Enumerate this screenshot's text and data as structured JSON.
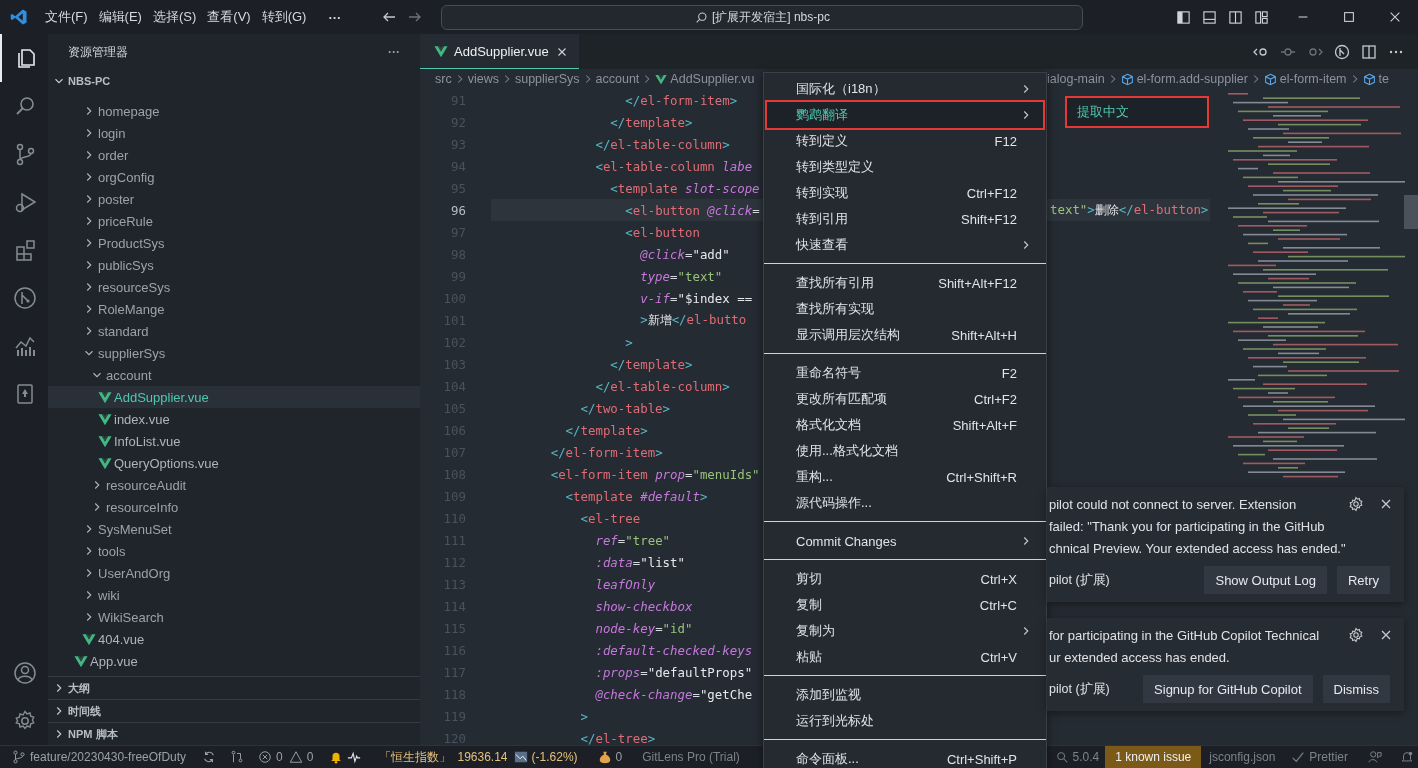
{
  "title_bar": {
    "menus": [
      "文件(F)",
      "编辑(E)",
      "选择(S)",
      "查看(V)",
      "转到(G)"
    ],
    "more": "···",
    "search": "[扩展开发宿主] nbs-pc"
  },
  "activity_bar": [
    {
      "selected": true
    },
    {
      "selected": false
    },
    {
      "selected": false
    },
    {
      "selected": false
    },
    {
      "selected": false
    },
    {
      "selected": false
    },
    {
      "selected": false
    },
    {
      "selected": false
    }
  ],
  "sidebar": {
    "title": "资源管理器",
    "more": "···",
    "root": {
      "label": "NBS-PC",
      "expanded": true
    },
    "tree": [
      {
        "children": [
          {
            "label": "homepage",
            "kind": "folder",
            "expanded": false,
            "selected": false
          },
          {
            "label": "login",
            "kind": "folder",
            "expanded": false,
            "selected": false
          },
          {
            "label": "order",
            "kind": "folder",
            "expanded": false,
            "selected": false
          },
          {
            "label": "orgConfig",
            "kind": "folder",
            "expanded": false,
            "selected": false
          },
          {
            "label": "poster",
            "kind": "folder",
            "expanded": false,
            "selected": false
          },
          {
            "label": "priceRule",
            "kind": "folder",
            "expanded": false,
            "selected": false
          },
          {
            "label": "ProductSys",
            "kind": "folder",
            "expanded": false,
            "selected": false
          },
          {
            "label": "publicSys",
            "kind": "folder",
            "expanded": false,
            "selected": false
          },
          {
            "label": "resourceSys",
            "kind": "folder",
            "expanded": false,
            "selected": false
          },
          {
            "label": "RoleMange",
            "kind": "folder",
            "expanded": false,
            "selected": false
          },
          {
            "label": "standard",
            "kind": "folder",
            "expanded": false,
            "selected": false
          },
          {
            "label": "supplierSys",
            "kind": "folder",
            "expanded": true,
            "selected": false,
            "children": [
              {
                "label": "account",
                "kind": "folder",
                "expanded": true,
                "selected": false,
                "children": [
                  {
                    "label": "AddSupplier.vue",
                    "kind": "file",
                    "selected": true
                  },
                  {
                    "label": "index.vue",
                    "kind": "file",
                    "selected": false
                  },
                  {
                    "label": "InfoList.vue",
                    "kind": "file",
                    "selected": false
                  },
                  {
                    "label": "QueryOptions.vue",
                    "kind": "file",
                    "selected": false
                  }
                ]
              },
              {
                "label": "resourceAudit",
                "kind": "folder",
                "expanded": false,
                "selected": false
              },
              {
                "label": "resourceInfo",
                "kind": "folder",
                "expanded": false,
                "selected": false
              }
            ]
          },
          {
            "label": "SysMenuSet",
            "kind": "folder",
            "expanded": false,
            "selected": false
          },
          {
            "label": "tools",
            "kind": "folder",
            "expanded": false,
            "selected": false
          },
          {
            "label": "UserAndOrg",
            "kind": "folder",
            "expanded": false,
            "selected": false
          },
          {
            "label": "wiki",
            "kind": "folder",
            "expanded": false,
            "selected": false
          },
          {
            "label": "WikiSearch",
            "kind": "folder",
            "expanded": false,
            "selected": false
          },
          {
            "label": "404.vue",
            "kind": "file",
            "selected": false
          }
        ]
      },
      {
        "label": "App.vue",
        "kind": "file",
        "selected": false
      }
    ],
    "sections": [
      {
        "label": "大纲",
        "expanded": false
      },
      {
        "label": "时间线",
        "expanded": false
      },
      {
        "label": "NPM 脚本",
        "expanded": false
      }
    ]
  },
  "editor": {
    "tab": {
      "label": "AddSupplier.vue",
      "selected": true
    },
    "breadcrumb_left": [
      {
        "label": "src",
        "kind": "folder"
      },
      {
        "label": "views",
        "kind": "folder"
      },
      {
        "label": "supplierSys",
        "kind": "folder"
      },
      {
        "label": "account",
        "kind": "folder"
      },
      {
        "label": "AddSupplier.vu",
        "kind": "file"
      }
    ],
    "breadcrumb_right": [
      {
        "label": "ialog-main",
        "kind": "plain"
      },
      {
        "label": "el-form.add-supplier",
        "kind": "symbol"
      },
      {
        "label": "el-form-item",
        "kind": "symbol"
      },
      {
        "label": "te",
        "kind": "symbol"
      }
    ],
    "lines": [
      {
        "number": "91",
        "current": false,
        "tokens": [
          {
            "kind": "punct",
            "text": "                  </"
          },
          {
            "kind": "tag",
            "text": "el-form-item"
          },
          {
            "kind": "punct",
            "text": ">"
          }
        ]
      },
      {
        "number": "92",
        "current": false,
        "tokens": [
          {
            "kind": "punct",
            "text": "                </"
          },
          {
            "kind": "tag",
            "text": "template"
          },
          {
            "kind": "punct",
            "text": ">"
          }
        ]
      },
      {
        "number": "93",
        "current": false,
        "tokens": [
          {
            "kind": "punct",
            "text": "              </"
          },
          {
            "kind": "tag",
            "text": "el-table-column"
          },
          {
            "kind": "punct",
            "text": ">"
          }
        ]
      },
      {
        "number": "94",
        "current": false,
        "tokens": [
          {
            "kind": "punct",
            "text": "              <"
          },
          {
            "kind": "tag",
            "text": "el-table-column "
          },
          {
            "kind": "attr",
            "text": "labe"
          }
        ]
      },
      {
        "number": "95",
        "current": false,
        "tokens": [
          {
            "kind": "punct",
            "text": "                <"
          },
          {
            "kind": "tag",
            "text": "template "
          },
          {
            "kind": "attr",
            "text": "slot-scope"
          }
        ]
      },
      {
        "number": "96",
        "current": true,
        "tokens": [
          {
            "kind": "punct",
            "text": "                  <"
          },
          {
            "kind": "tag",
            "text": "el-button "
          },
          {
            "kind": "attr",
            "text": "@click"
          },
          {
            "kind": "op",
            "text": "="
          }
        ],
        "tail": [
          {
            "kind": "string",
            "text": "text\""
          },
          {
            "kind": "punct",
            "text": ">"
          },
          {
            "kind": "text",
            "text": "删除"
          },
          {
            "kind": "punct",
            "text": "</"
          },
          {
            "kind": "tag",
            "text": "el-button"
          },
          {
            "kind": "punct",
            "text": ">"
          }
        ]
      },
      {
        "number": "97",
        "current": false,
        "tokens": [
          {
            "kind": "punct",
            "text": "                  <"
          },
          {
            "kind": "tag",
            "text": "el-button"
          }
        ]
      },
      {
        "number": "98",
        "current": false,
        "tokens": [
          {
            "kind": "attr",
            "text": "                    @click"
          },
          {
            "kind": "op",
            "text": "="
          },
          {
            "kind": "value",
            "text": "\"add\""
          }
        ]
      },
      {
        "number": "99",
        "current": false,
        "tokens": [
          {
            "kind": "attr",
            "text": "                    type"
          },
          {
            "kind": "op",
            "text": "="
          },
          {
            "kind": "string",
            "text": "\"text\""
          }
        ]
      },
      {
        "number": "100",
        "current": false,
        "tokens": [
          {
            "kind": "attr",
            "text": "                    v-if"
          },
          {
            "kind": "op",
            "text": "="
          },
          {
            "kind": "value",
            "text": "\"$index =="
          }
        ]
      },
      {
        "number": "101",
        "current": false,
        "tokens": [
          {
            "kind": "punct",
            "text": "                    >"
          },
          {
            "kind": "text",
            "text": "新增"
          },
          {
            "kind": "punct",
            "text": "</"
          },
          {
            "kind": "tag",
            "text": "el-butto"
          }
        ]
      },
      {
        "number": "102",
        "current": false,
        "tokens": [
          {
            "kind": "punct",
            "text": "                  >"
          }
        ]
      },
      {
        "number": "103",
        "current": false,
        "tokens": [
          {
            "kind": "punct",
            "text": "                </"
          },
          {
            "kind": "tag",
            "text": "template"
          },
          {
            "kind": "punct",
            "text": ">"
          }
        ]
      },
      {
        "number": "104",
        "current": false,
        "tokens": [
          {
            "kind": "punct",
            "text": "              </"
          },
          {
            "kind": "tag",
            "text": "el-table-column"
          },
          {
            "kind": "punct",
            "text": ">"
          }
        ]
      },
      {
        "number": "105",
        "current": false,
        "tokens": [
          {
            "kind": "punct",
            "text": "            </"
          },
          {
            "kind": "tag",
            "text": "two-table"
          },
          {
            "kind": "punct",
            "text": ">"
          }
        ]
      },
      {
        "number": "106",
        "current": false,
        "tokens": [
          {
            "kind": "punct",
            "text": "          </"
          },
          {
            "kind": "tag",
            "text": "template"
          },
          {
            "kind": "punct",
            "text": ">"
          }
        ]
      },
      {
        "number": "107",
        "current": false,
        "tokens": [
          {
            "kind": "punct",
            "text": "        </"
          },
          {
            "kind": "tag",
            "text": "el-form-item"
          },
          {
            "kind": "punct",
            "text": ">"
          }
        ]
      },
      {
        "number": "108",
        "current": false,
        "tokens": [
          {
            "kind": "punct",
            "text": "        <"
          },
          {
            "kind": "tag",
            "text": "el-form-item "
          },
          {
            "kind": "attr",
            "text": "prop"
          },
          {
            "kind": "op",
            "text": "="
          },
          {
            "kind": "string",
            "text": "\"menuIds\""
          }
        ]
      },
      {
        "number": "109",
        "current": false,
        "tokens": [
          {
            "kind": "punct",
            "text": "          <"
          },
          {
            "kind": "tag",
            "text": "template "
          },
          {
            "kind": "attr",
            "text": "#default"
          },
          {
            "kind": "punct",
            "text": ">"
          }
        ]
      },
      {
        "number": "110",
        "current": false,
        "tokens": [
          {
            "kind": "punct",
            "text": "            <"
          },
          {
            "kind": "tag",
            "text": "el-tree"
          }
        ]
      },
      {
        "number": "111",
        "current": false,
        "tokens": [
          {
            "kind": "attr",
            "text": "              ref"
          },
          {
            "kind": "op",
            "text": "="
          },
          {
            "kind": "string",
            "text": "\"tree\""
          }
        ]
      },
      {
        "number": "112",
        "current": false,
        "tokens": [
          {
            "kind": "attr",
            "text": "              :data"
          },
          {
            "kind": "op",
            "text": "="
          },
          {
            "kind": "value",
            "text": "\"list\""
          }
        ]
      },
      {
        "number": "113",
        "current": false,
        "tokens": [
          {
            "kind": "attr",
            "text": "              leafOnly"
          }
        ]
      },
      {
        "number": "114",
        "current": false,
        "tokens": [
          {
            "kind": "attr",
            "text": "              show-checkbox"
          }
        ]
      },
      {
        "number": "115",
        "current": false,
        "tokens": [
          {
            "kind": "attr",
            "text": "              node-key"
          },
          {
            "kind": "op",
            "text": "="
          },
          {
            "kind": "string",
            "text": "\"id\""
          }
        ]
      },
      {
        "number": "116",
        "current": false,
        "tokens": [
          {
            "kind": "attr",
            "text": "              :default-checked-keys"
          }
        ]
      },
      {
        "number": "117",
        "current": false,
        "tokens": [
          {
            "kind": "attr",
            "text": "              :props"
          },
          {
            "kind": "op",
            "text": "="
          },
          {
            "kind": "value",
            "text": "\"defaultProps\""
          }
        ]
      },
      {
        "number": "118",
        "current": false,
        "tokens": [
          {
            "kind": "attr",
            "text": "              @check-change"
          },
          {
            "kind": "op",
            "text": "="
          },
          {
            "kind": "value",
            "text": "\"getChe"
          }
        ]
      },
      {
        "number": "119",
        "current": false,
        "tokens": [
          {
            "kind": "punct",
            "text": "            >"
          }
        ]
      },
      {
        "number": "120",
        "current": false,
        "tokens": [
          {
            "kind": "punct",
            "text": "            </"
          },
          {
            "kind": "tag",
            "text": "el-tree"
          },
          {
            "kind": "punct",
            "text": ">"
          }
        ]
      }
    ]
  },
  "context_menu": {
    "items": [
      {
        "kind": "item",
        "label": "国际化（i18n）",
        "submenu": true,
        "selected": false
      },
      {
        "kind": "item",
        "label": "鹦鹉翻译",
        "submenu": true,
        "selected": true
      },
      {
        "kind": "item",
        "label": "转到定义",
        "shortcut": "F12",
        "submenu": false,
        "selected": false
      },
      {
        "kind": "item",
        "label": "转到类型定义",
        "submenu": false,
        "selected": false
      },
      {
        "kind": "item",
        "label": "转到实现",
        "shortcut": "Ctrl+F12",
        "submenu": false,
        "selected": false
      },
      {
        "kind": "item",
        "label": "转到引用",
        "shortcut": "Shift+F12",
        "submenu": false,
        "selected": false
      },
      {
        "kind": "item",
        "label": "快速查看",
        "submenu": true,
        "selected": false
      },
      {
        "kind": "separator"
      },
      {
        "kind": "item",
        "label": "查找所有引用",
        "shortcut": "Shift+Alt+F12",
        "submenu": false,
        "selected": false
      },
      {
        "kind": "item",
        "label": "查找所有实现",
        "submenu": false,
        "selected": false
      },
      {
        "kind": "item",
        "label": "显示调用层次结构",
        "shortcut": "Shift+Alt+H",
        "submenu": false,
        "selected": false
      },
      {
        "kind": "separator"
      },
      {
        "kind": "item",
        "label": "重命名符号",
        "shortcut": "F2",
        "submenu": false,
        "selected": false
      },
      {
        "kind": "item",
        "label": "更改所有匹配项",
        "shortcut": "Ctrl+F2",
        "submenu": false,
        "selected": false
      },
      {
        "kind": "item",
        "label": "格式化文档",
        "shortcut": "Shift+Alt+F",
        "submenu": false,
        "selected": false
      },
      {
        "kind": "item",
        "label": "使用...格式化文档",
        "submenu": false,
        "selected": false
      },
      {
        "kind": "item",
        "label": "重构...",
        "shortcut": "Ctrl+Shift+R",
        "submenu": false,
        "selected": false
      },
      {
        "kind": "item",
        "label": "源代码操作...",
        "submenu": false,
        "selected": false
      },
      {
        "kind": "separator"
      },
      {
        "kind": "item",
        "label": "Commit Changes",
        "submenu": true,
        "selected": false
      },
      {
        "kind": "separator"
      },
      {
        "kind": "item",
        "label": "剪切",
        "shortcut": "Ctrl+X",
        "submenu": false,
        "selected": false
      },
      {
        "kind": "item",
        "label": "复制",
        "shortcut": "Ctrl+C",
        "submenu": false,
        "selected": false
      },
      {
        "kind": "item",
        "label": "复制为",
        "submenu": true,
        "selected": false
      },
      {
        "kind": "item",
        "label": "粘贴",
        "shortcut": "Ctrl+V",
        "submenu": false,
        "selected": false
      },
      {
        "kind": "separator"
      },
      {
        "kind": "item",
        "label": "添加到监视",
        "submenu": false,
        "selected": false
      },
      {
        "kind": "item",
        "label": "运行到光标处",
        "submenu": false,
        "selected": false
      },
      {
        "kind": "separator"
      },
      {
        "kind": "item",
        "label": "命令面板...",
        "shortcut": "Ctrl+Shift+P",
        "submenu": false,
        "selected": false
      }
    ]
  },
  "submenu": {
    "items": [
      {
        "label": "提取中文",
        "selected": true
      }
    ]
  },
  "notifications": [
    {
      "lines": [
        "pilot could not connect to server. Extension",
        "failed: \"Thank you for participating in the GitHub",
        "chnical Preview. Your extended access has ended.\""
      ],
      "source": "pilot (扩展)",
      "buttons": [
        "Show Output Log",
        "Retry"
      ]
    },
    {
      "lines": [
        "for participating in the GitHub Copilot Technical",
        "ur extended access has ended."
      ],
      "source": "pilot (扩展)",
      "buttons": [
        "Signup for GitHub Copilot",
        "Dismiss"
      ]
    }
  ],
  "status_bar": {
    "branch": "feature/20230430-freeOfDuty",
    "errors": "0",
    "warnings": "0",
    "stock_name": "「恒生指数」",
    "stock_value": "19636.14",
    "stock_change": "(-1.62%)",
    "coins": "0",
    "gitlens": "GitLens Pro (Trial)",
    "version": "5.0.4",
    "known_issue": "1 known issue",
    "config": "jsconfig.json",
    "formatter": "Prettier"
  }
}
